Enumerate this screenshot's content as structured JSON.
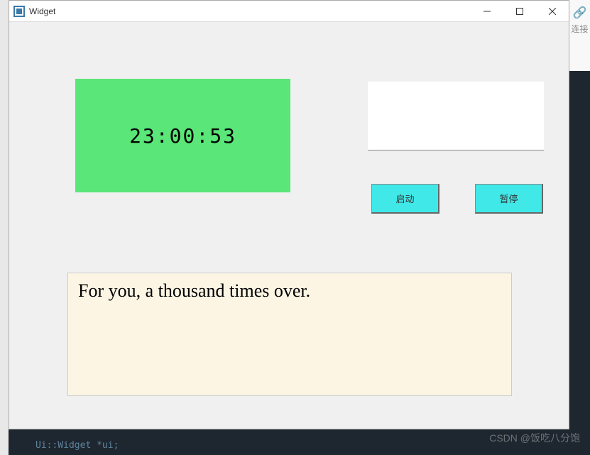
{
  "window": {
    "title": "Widget"
  },
  "clock": {
    "time": "23:00:53"
  },
  "input": {
    "value": ""
  },
  "buttons": {
    "start": "启动",
    "pause": "暂停"
  },
  "output": {
    "text": "For you, a thousand times over."
  },
  "sidebar": {
    "link_label": "连接"
  },
  "watermark": {
    "text": "CSDN @饭吃八分饱"
  },
  "background": {
    "code_fragment": "Ui::Widget *ui;"
  }
}
